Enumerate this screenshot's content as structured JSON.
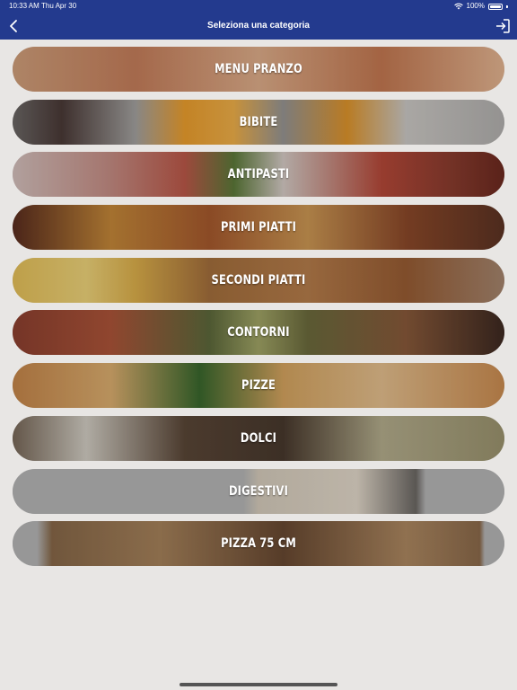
{
  "status_bar": {
    "time": "10:33 AM",
    "date": "Thu Apr 30",
    "battery": "100%"
  },
  "header": {
    "title": "Seleziona una categoria"
  },
  "categories": [
    {
      "label": "MENU PRANZO"
    },
    {
      "label": "BIBITE"
    },
    {
      "label": "ANTIPASTI"
    },
    {
      "label": "PRIMI PIATTI"
    },
    {
      "label": "SECONDI PIATTI"
    },
    {
      "label": "CONTORNI"
    },
    {
      "label": "PIZZE"
    },
    {
      "label": "DOLCI"
    },
    {
      "label": "DIGESTIVI"
    },
    {
      "label": "PIZZA 75 CM"
    }
  ],
  "colors": {
    "header_bg": "#233a8e",
    "page_bg": "#e8e6e4"
  }
}
